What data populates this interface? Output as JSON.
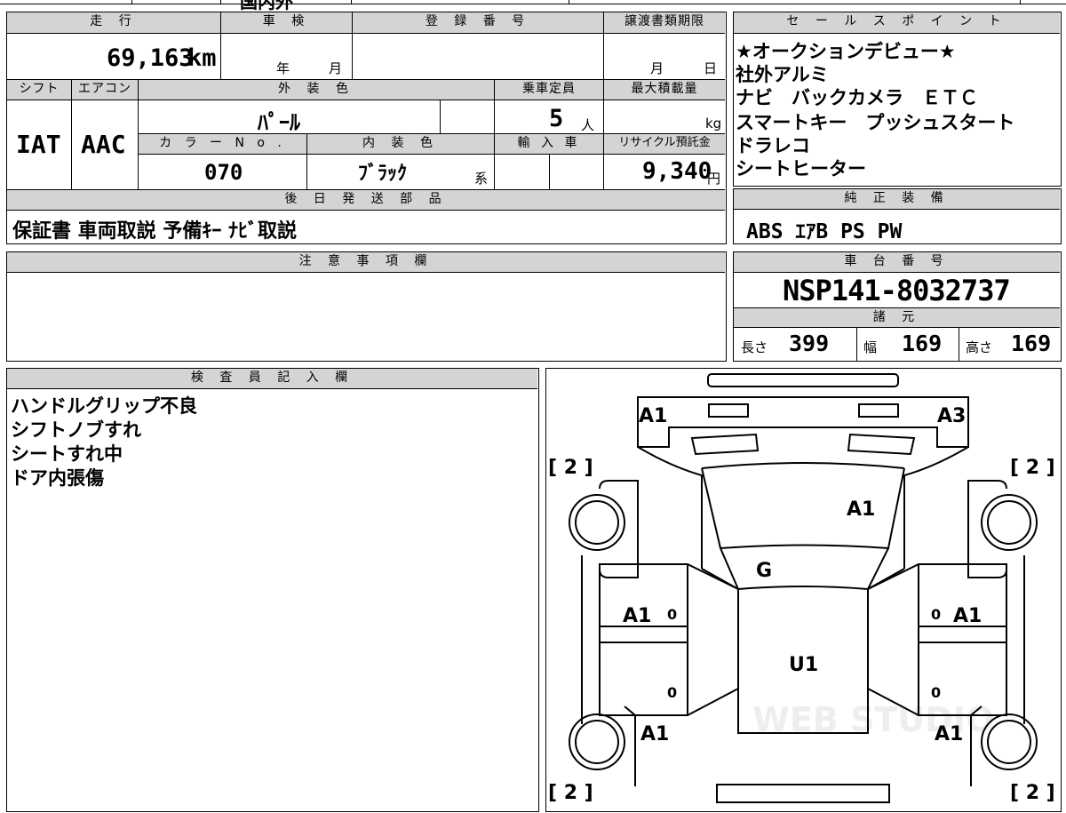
{
  "top_row": {
    "title_fragment": "国内外"
  },
  "mileage": {
    "label": "走 行",
    "value": "69,163",
    "unit": "km"
  },
  "shaken": {
    "label": "車 検",
    "year_label": "年",
    "month_label": "月"
  },
  "registration_number": {
    "label": "登 録 番 号",
    "value": ""
  },
  "transfer_deadline": {
    "label": "譲渡書類期限",
    "month_label": "月",
    "day_label": "日"
  },
  "shift": {
    "label": "シフト",
    "value": "IAT"
  },
  "aircon": {
    "label": "エアコン",
    "value": "AAC"
  },
  "exterior_color": {
    "label": "外 装 色",
    "value": "ﾊﾟｰﾙ"
  },
  "capacity": {
    "label": "乗車定員",
    "value": "5",
    "unit": "人"
  },
  "max_load": {
    "label": "最大積載量",
    "value": "",
    "unit": "kg"
  },
  "color_no": {
    "label": "カ ラ ー N o .",
    "value": "070"
  },
  "interior_color": {
    "label": "内 装 色",
    "value": "ﾌﾞﾗｯｸ",
    "suffix": "系"
  },
  "import_car": {
    "label": "輸 入 車"
  },
  "recycle_fee": {
    "label": "リサイクル預託金",
    "value": "9,340",
    "unit": "円"
  },
  "later_shipping": {
    "label": "後 日 発 送 部 品",
    "items": "保証書 車両取説 予備ｷｰ ﾅﾋﾞ取説"
  },
  "sales_points": {
    "label": "セ ー ル ス ポ イ ン ト",
    "lines": [
      "★オークションデビュー★",
      "社外アルミ",
      "ナビ　バックカメラ　ＥＴＣ",
      "スマートキー　プッシュスタート",
      "ドラレコ",
      "シートヒーター"
    ]
  },
  "standard_equipment": {
    "label": "純 正 装 備",
    "value": "ABS ｴｱB PS PW"
  },
  "notes": {
    "label": "注 意 事 項 欄",
    "value": ""
  },
  "chassis_number": {
    "label": "車 台 番 号",
    "value": "NSP141-8032737"
  },
  "specs": {
    "label": "諸 元",
    "length_label": "長さ",
    "length": "399",
    "width_label": "幅",
    "width": "169",
    "height_label": "高さ",
    "height": "169"
  },
  "inspector_notes": {
    "label": "検 査 員 記 入 欄",
    "lines": [
      "ハンドルグリップ不良",
      "シフトノブすれ",
      "シートすれ中",
      "ドア内張傷"
    ]
  },
  "diagram": {
    "marks": {
      "front_left": "A1",
      "front_right": "A3",
      "hood": "A1",
      "windshield": "G",
      "roof": "U1",
      "left_front_door": "A1",
      "right_front_door": "A1",
      "left_rear": "A1",
      "right_rear": "A1"
    },
    "tire_labels": [
      "[ 2 ]",
      "[ 2 ]",
      "[ 2 ]",
      "[ 2 ]"
    ],
    "door_zero": "0",
    "watermark": "WEB STUDIO"
  }
}
